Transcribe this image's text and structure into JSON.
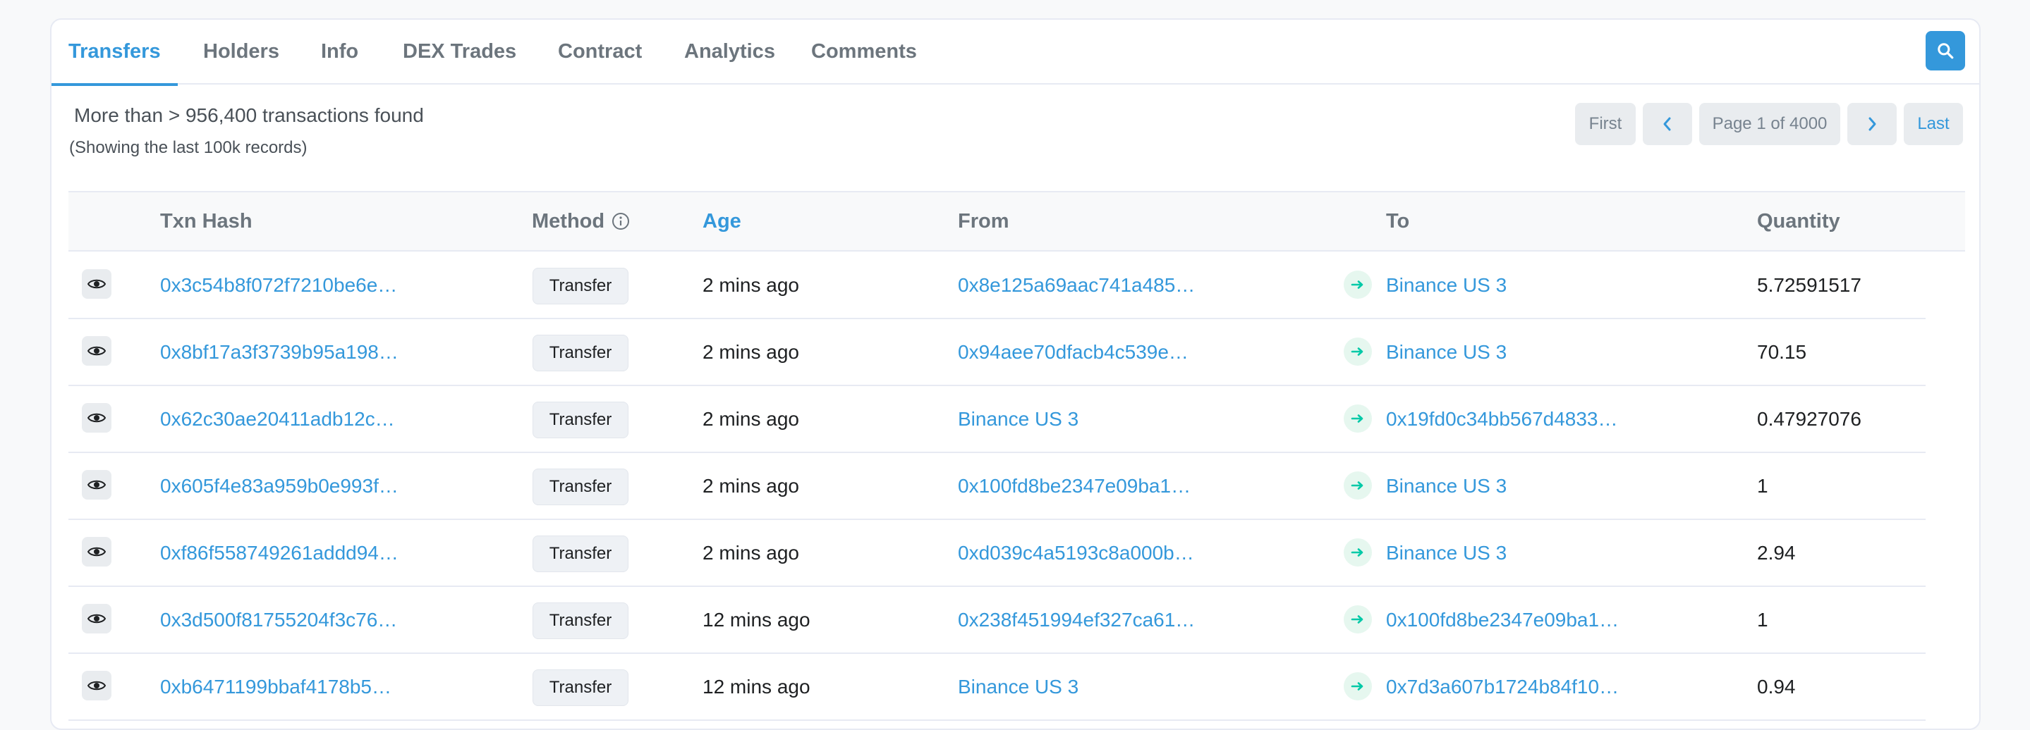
{
  "tabs": [
    {
      "label": "Transfers",
      "active": true
    },
    {
      "label": "Holders"
    },
    {
      "label": "Info"
    },
    {
      "label": "DEX Trades"
    },
    {
      "label": "Contract"
    },
    {
      "label": "Analytics"
    },
    {
      "label": "Comments"
    }
  ],
  "summary": {
    "main": "More than > 956,400 transactions found",
    "sub": "(Showing the last 100k records)"
  },
  "pagination": {
    "first": "First",
    "page": "Page 1 of 4000",
    "last": "Last"
  },
  "table": {
    "headers": {
      "txn_hash": "Txn Hash",
      "method": "Method",
      "age": "Age",
      "from": "From",
      "to": "To",
      "quantity": "Quantity"
    },
    "rows": [
      {
        "hash": "0x3c54b8f072f7210be6e…",
        "method": "Transfer",
        "age": "2 mins ago",
        "from": "0x8e125a69aac741a485…",
        "to": "Binance US 3",
        "quantity": "5.72591517"
      },
      {
        "hash": "0x8bf17a3f3739b95a198…",
        "method": "Transfer",
        "age": "2 mins ago",
        "from": "0x94aee70dfacb4c539e…",
        "to": "Binance US 3",
        "quantity": "70.15"
      },
      {
        "hash": "0x62c30ae20411adb12c…",
        "method": "Transfer",
        "age": "2 mins ago",
        "from": "Binance US 3",
        "to": "0x19fd0c34bb567d4833…",
        "quantity": "0.47927076"
      },
      {
        "hash": "0x605f4e83a959b0e993f…",
        "method": "Transfer",
        "age": "2 mins ago",
        "from": "0x100fd8be2347e09ba1…",
        "to": "Binance US 3",
        "quantity": "1"
      },
      {
        "hash": "0xf86f558749261addd94…",
        "method": "Transfer",
        "age": "2 mins ago",
        "from": "0xd039c4a5193c8a000b…",
        "to": "Binance US 3",
        "quantity": "2.94"
      },
      {
        "hash": "0x3d500f81755204f3c76…",
        "method": "Transfer",
        "age": "12 mins ago",
        "from": "0x238f451994ef327ca61…",
        "to": "0x100fd8be2347e09ba1…",
        "quantity": "1"
      },
      {
        "hash": "0xb6471199bbaf4178b5…",
        "method": "Transfer",
        "age": "12 mins ago",
        "from": "Binance US 3",
        "to": "0x7d3a607b1724b84f10…",
        "quantity": "0.94"
      }
    ]
  },
  "colors": {
    "accent": "#3498db",
    "arrow": "#00c9a7"
  }
}
